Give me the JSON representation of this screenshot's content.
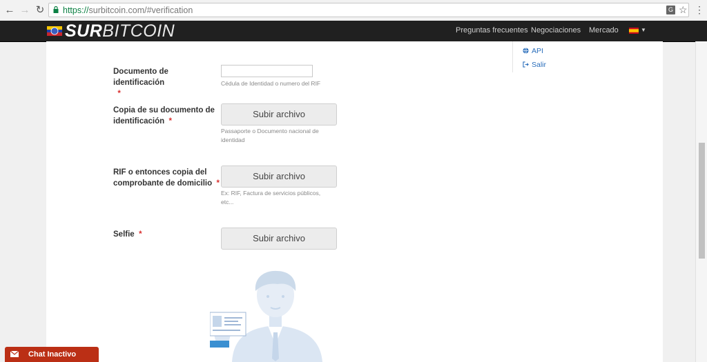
{
  "browser": {
    "url_protocol": "https://",
    "url_rest": "surbitcoin.com/#verification"
  },
  "header": {
    "logo_bold": "SUR",
    "logo_light": "BITCOIN",
    "nav": [
      "Preguntas frecuentes",
      "Negociaciones",
      "Mercado"
    ]
  },
  "sidebar": {
    "links": [
      {
        "label": "API",
        "icon": "globe-icon"
      },
      {
        "label": "Salir",
        "icon": "sign-out-icon"
      }
    ]
  },
  "form": {
    "required_mark": "*",
    "fields": [
      {
        "label": "Documento de identificación",
        "help": "Cédula de Identidad o numero del RIF"
      },
      {
        "label": "Copia de su documento de identificación",
        "button": "Subir archivo",
        "help": "Passaporte o Documento nacional de identidad"
      },
      {
        "label": "RIF o entonces copia del comprobante de domicilio",
        "button": "Subir archivo",
        "help": "Ex: RIF, Factura de servicios públicos, etc..."
      },
      {
        "label": "Selfie",
        "button": "Subir archivo"
      }
    ],
    "id_input_value": ""
  },
  "chat": {
    "label": "Chat Inactivo"
  },
  "colors": {
    "brand_red": "#bb2f15",
    "link_blue": "#2a6ebb",
    "required_red": "#d9302f"
  }
}
